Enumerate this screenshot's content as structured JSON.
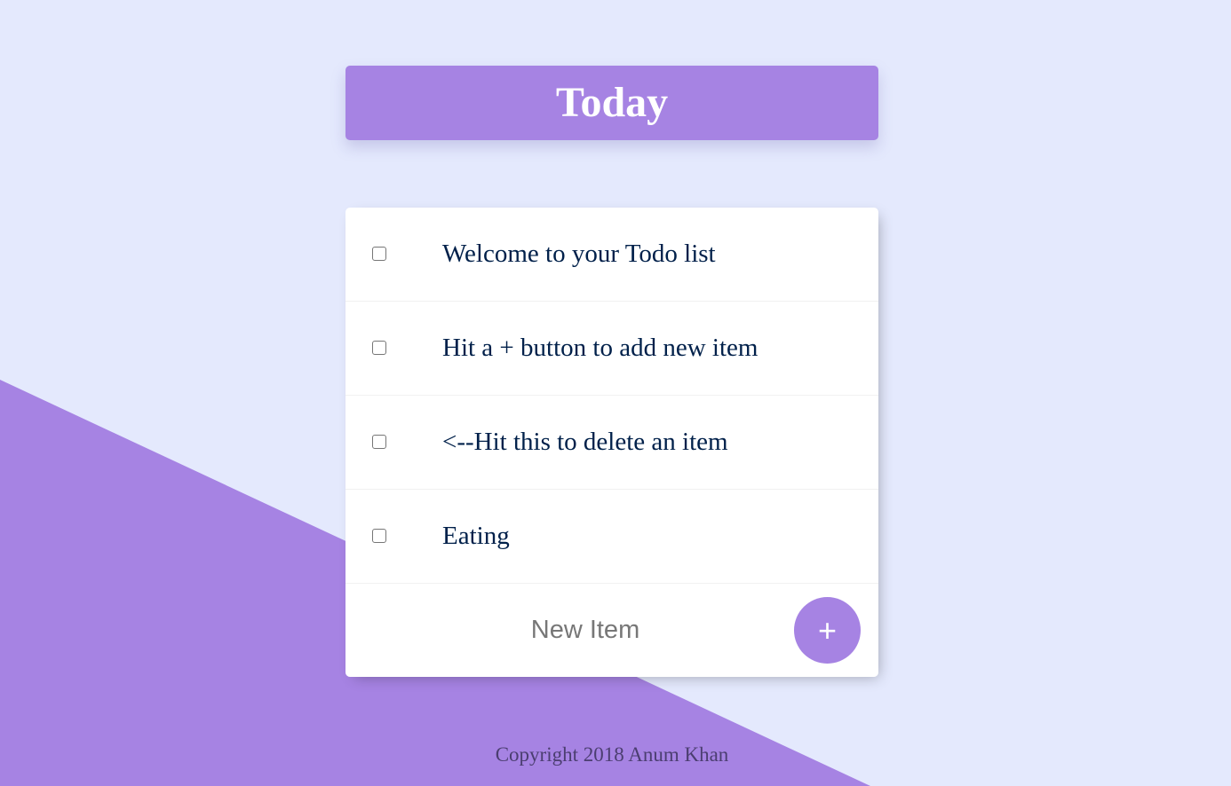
{
  "heading": {
    "title": "Today"
  },
  "items": [
    {
      "label": "Welcome to your Todo list",
      "checked": false
    },
    {
      "label": "Hit a + button to add new item",
      "checked": false
    },
    {
      "label": "<--Hit this to delete an item",
      "checked": false
    },
    {
      "label": "Eating",
      "checked": false
    }
  ],
  "new_item": {
    "placeholder": "New Item",
    "add_label": "+"
  },
  "footer": {
    "copyright": "Copyright 2018 Anum Khan"
  },
  "colors": {
    "background": "#E4E9FD",
    "accent": "#A683E3",
    "item_text": "#00204A"
  }
}
